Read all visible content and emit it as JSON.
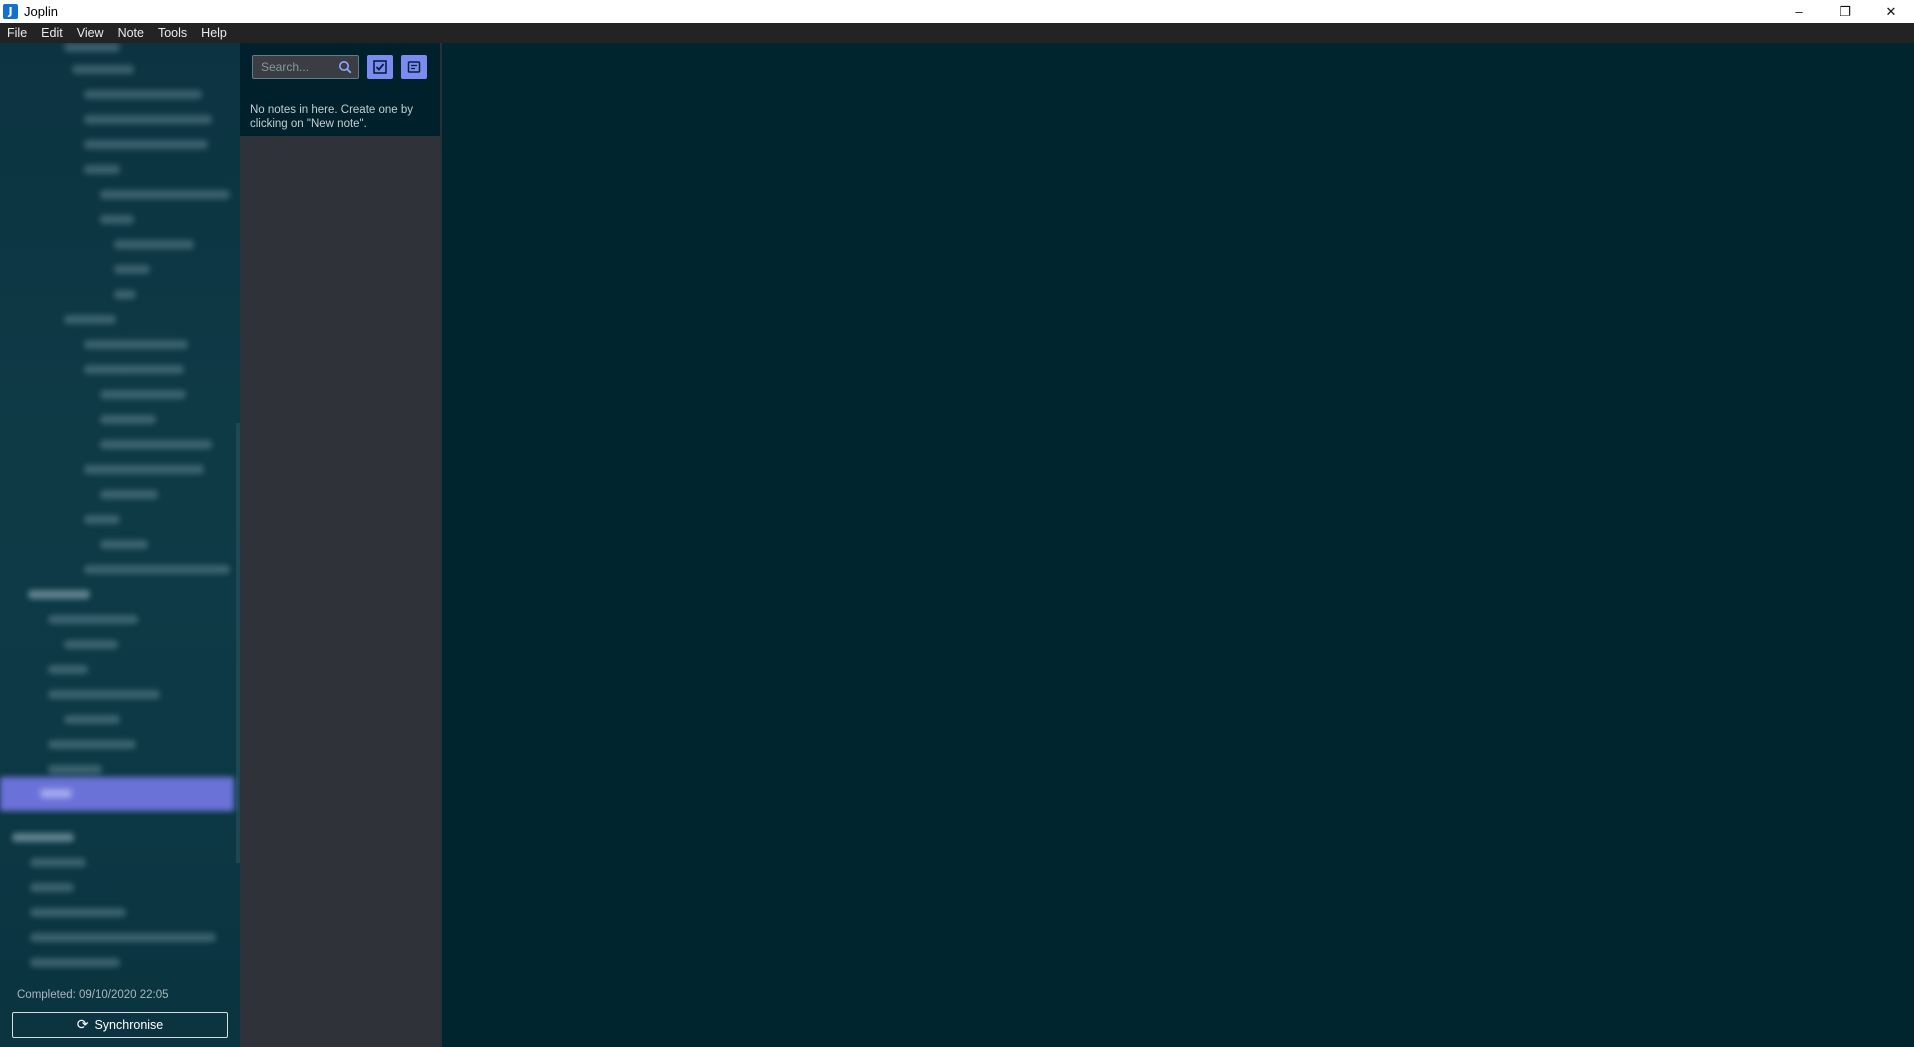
{
  "window": {
    "title": "Joplin",
    "icon_letter": "J",
    "controls": {
      "minimize": "–",
      "restore": "❐",
      "close": "✕"
    }
  },
  "menu": {
    "items": [
      "File",
      "Edit",
      "View",
      "Note",
      "Tools",
      "Help"
    ]
  },
  "sidebar": {
    "sync_status": "Completed: 09/10/2020 22:05",
    "sync_button_label": "Synchronise"
  },
  "note_list": {
    "search_placeholder": "Search...",
    "empty_message": "No notes in here. Create one by clicking on \"New note\"."
  },
  "colors": {
    "accent": "#7a8cf0",
    "selected": "#6a72d8",
    "sidebar_bg": "#0c3341",
    "editor_bg": "#00252f"
  }
}
